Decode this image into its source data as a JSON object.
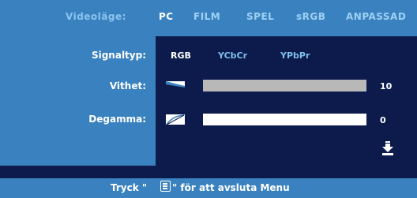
{
  "header": {
    "label": "Videoläge:",
    "modes": [
      "PC",
      "FILM",
      "SPEL",
      "sRGB",
      "ANPASSAD"
    ],
    "active_mode": "PC"
  },
  "rows": {
    "signal": {
      "label": "Signaltyp:",
      "options": [
        "RGB",
        "YCbCr",
        "YPbPr"
      ],
      "active": "RGB"
    },
    "white": {
      "label": "Vithet:",
      "value": "10",
      "level": 1.0,
      "icon": "whiteness-icon"
    },
    "degamma": {
      "label": "Degamma:",
      "value": "0",
      "level": 0.0,
      "icon": "degamma-curve-icon"
    }
  },
  "footer": {
    "prefix": "Tryck \"",
    "suffix": "\" för att avsluta Menu",
    "icon": "menu-icon"
  },
  "colors": {
    "panel": "#3a82bf",
    "dark": "#0d1a4c",
    "inactive": "#7ec0ee",
    "bar_full": "#b8b8b8"
  },
  "scroll_icon": "scroll-down-arrow-icon"
}
